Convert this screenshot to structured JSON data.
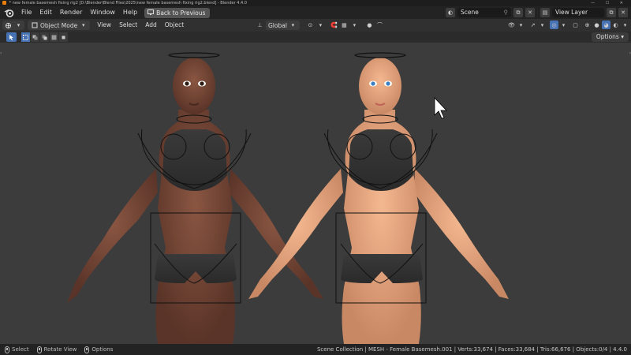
{
  "window": {
    "title": "* new female basemesh fixing rig2 [D:\\Blender\\Blend Files\\2025\\new female basemesh fixing rig2.blend] - Blender 4.4.0",
    "controls": "— ☐ ✕"
  },
  "menubar": {
    "items": [
      "File",
      "Edit",
      "Render",
      "Window",
      "Help"
    ],
    "back_button": "Back to Previous",
    "scene_name": "Scene",
    "view_layer": "View Layer"
  },
  "header": {
    "mode": "Object Mode",
    "menus": [
      "View",
      "Select",
      "Add",
      "Object"
    ],
    "transform_orientation": "Global"
  },
  "toolrow": {
    "options_label": "Options"
  },
  "statusbar": {
    "hints": [
      {
        "label": "Select"
      },
      {
        "label": "Rotate View"
      },
      {
        "label": "Options"
      }
    ],
    "stats": "Scene Collection | MESH - Female Basemesh.001 | Verts:33,674 | Faces:33,684 | Tris:66,676 | Objects:0/4 | 4.4.0"
  },
  "colors": {
    "accent": "#4772b3",
    "blender_orange": "#e87d0d",
    "viewport_bg": "#3c3c3c",
    "skin_dark": "#7a4a38",
    "skin_light": "#e8a57d"
  },
  "icons": {
    "editor_type": "viewport-icon",
    "select_tool": "select-box-icon",
    "cursor": "mouse-cursor-icon"
  }
}
